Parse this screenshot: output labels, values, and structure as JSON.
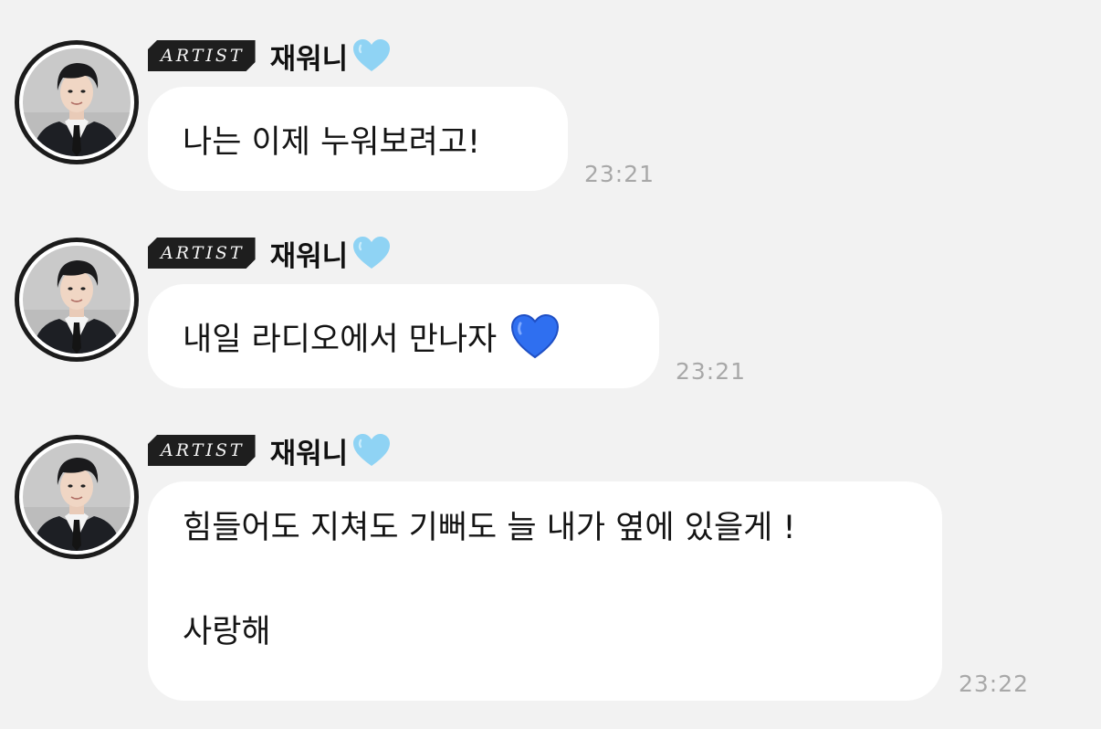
{
  "messages": [
    {
      "badge": "ARTIST",
      "sender": "재워니",
      "lines": [
        "나는 이제 누워보려고!"
      ],
      "time": "23:21"
    },
    {
      "badge": "ARTIST",
      "sender": "재워니",
      "lines": [
        "내일 라디오에서 만나자"
      ],
      "time": "23:21"
    },
    {
      "badge": "ARTIST",
      "sender": "재워니",
      "lines": [
        "힘들어도 지쳐도 기뻐도 늘 내가 옆에 있을게 !",
        "사랑해"
      ],
      "time": "23:22"
    }
  ],
  "icons": {
    "name_heart": "light-blue-heart-icon",
    "message_heart": "blue-heart-icon"
  },
  "colors": {
    "background": "#f2f2f2",
    "bubble": "#ffffff",
    "badge": "#1e1e1e",
    "time": "#a8a8a8",
    "light_heart": "#8fd3f4",
    "blue_heart": "#2f6ff0"
  }
}
